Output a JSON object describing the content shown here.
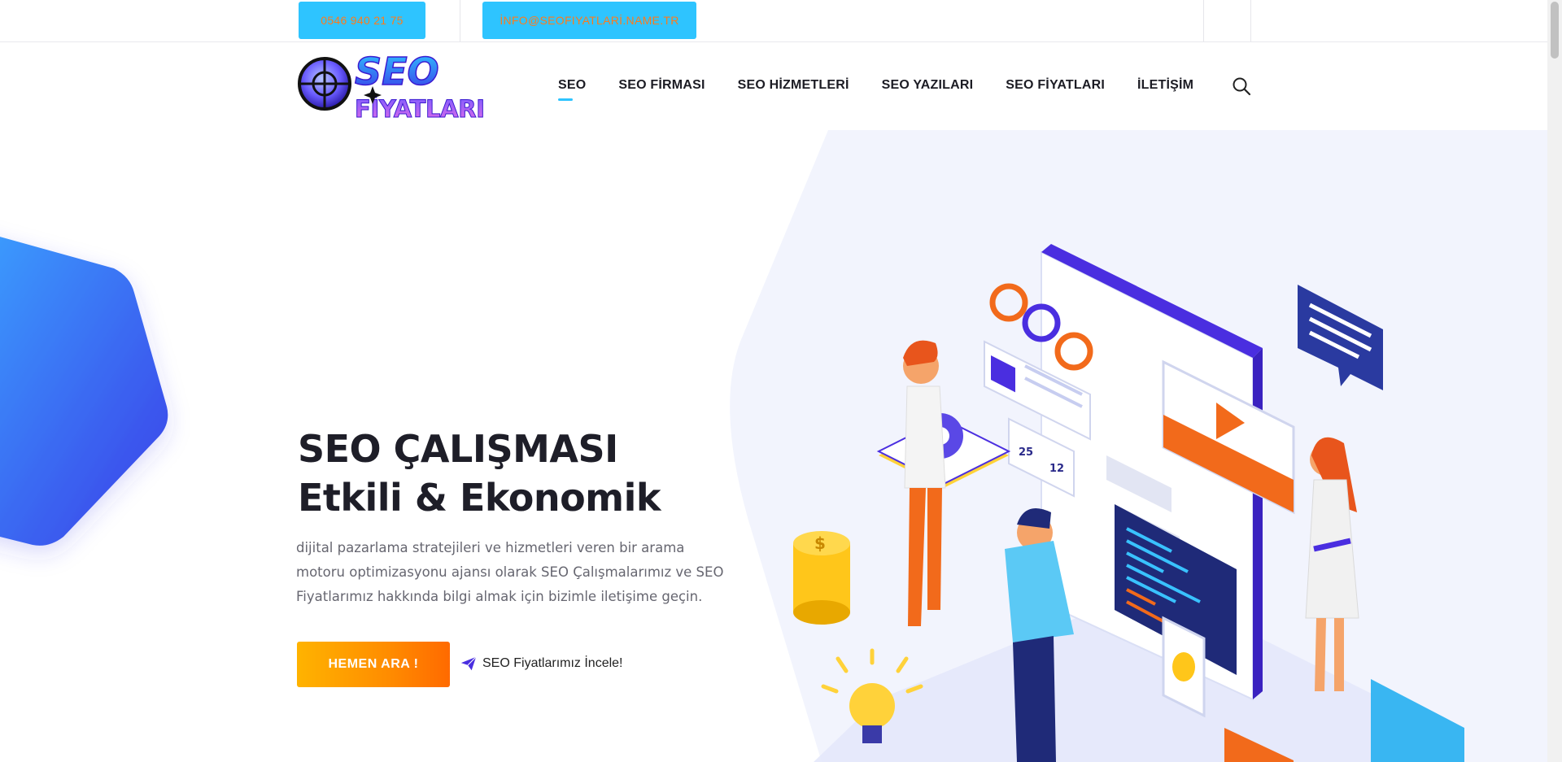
{
  "topbar": {
    "phone": "0546 940 21 75",
    "email": "İNFO@SEOFIYATLARİ.NAME.TR"
  },
  "header": {
    "logo_text_top": "SEO",
    "logo_text_bottom": "FİYATLARI",
    "nav": [
      {
        "label": "SEO",
        "active": true
      },
      {
        "label": "SEO FİRMASI",
        "active": false
      },
      {
        "label": "SEO HİZMETLERİ",
        "active": false
      },
      {
        "label": "SEO YAZILARI",
        "active": false
      },
      {
        "label": "SEO FİYATLARI",
        "active": false
      },
      {
        "label": "İLETİŞİM",
        "active": false
      }
    ]
  },
  "hero": {
    "title_line1": "SEO ÇALIŞMASI",
    "title_line2": "Etkili & Ekonomik",
    "description": "dijital pazarlama stratejileri ve hizmetleri veren bir arama motoru optimizasyonu ajansı olarak SEO Çalışmalarımız ve SEO Fiyatlarımız hakkında bilgi almak için bizimle iletişime geçin.",
    "cta_label": "HEMEN ARA !",
    "secondary_label": "SEO Fiyatlarımız İncele!"
  },
  "illustration": {
    "likes": "25",
    "comments": "12",
    "coin_symbol": "$"
  },
  "colors": {
    "accent": "#2ec4ff",
    "cta_start": "#ffb300",
    "cta_end": "#ff6a00",
    "brand_purple": "#4a2ee0",
    "orange": "#f26a1b"
  }
}
